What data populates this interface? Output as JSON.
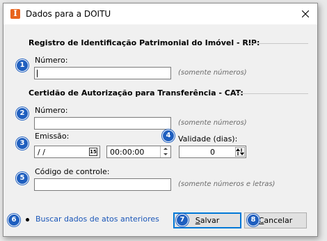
{
  "window": {
    "title": "Dados para a DOITU"
  },
  "rip": {
    "section_title": "Registro de Identificação Patrimonial do Imóvel - RIP:",
    "numero_label": "Número:",
    "numero_value": "",
    "numero_hint": "(somente números)"
  },
  "cat": {
    "section_title": "Certidão de Autorização para Transferência - CAT:",
    "numero_label": "Número:",
    "numero_value": "",
    "numero_hint": "(somente números)",
    "emissao_label": "Emissão:",
    "emissao_date": "/ /",
    "calendar_icon_text": "15",
    "emissao_time": "00:00:00",
    "validade_label": "Validade (dias):",
    "validade_value": "0",
    "codigo_label": "Código de controle:",
    "codigo_value": "",
    "codigo_hint": "(somente números e letras)"
  },
  "footer": {
    "buscar_link": "Buscar dados de atos anteriores",
    "salvar_label_ul": "S",
    "salvar_label_rest": "alvar",
    "cancelar_label_ul": "C",
    "cancelar_label_rest": "ancelar"
  },
  "badges": [
    "1",
    "2",
    "3",
    "4",
    "5",
    "6",
    "7",
    "8"
  ],
  "colors": {
    "badge": "#1f5fbf",
    "link": "#1a56b8",
    "app_icon": "#e8641e",
    "default_button_border": "#0078d7"
  },
  "icons": {
    "app": "app-icon",
    "close": "close-icon",
    "calendar": "calendar-icon",
    "spinner": "spinner-icon"
  }
}
